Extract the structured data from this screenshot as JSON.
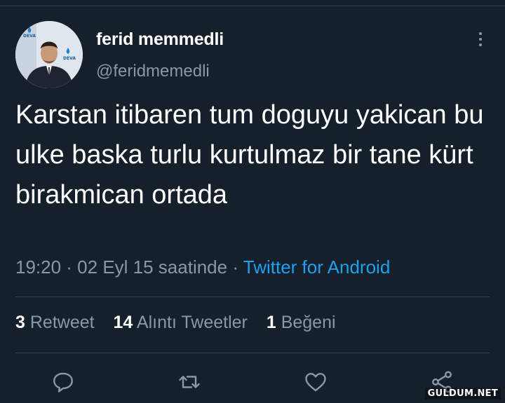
{
  "author": {
    "display_name": "ferid memmedli",
    "handle": "@feridmemedli",
    "avatar_badge_text": "DEVA"
  },
  "tweet": {
    "text": "Karstan itibaren tum doguyu yakican bu ulke baska turlu kurtulmaz bir tane kürt birakmican ortada",
    "timestamp": "19:20 · 02 Eyl 15 saatinde",
    "separator": " · ",
    "source": "Twitter for Android"
  },
  "stats": {
    "retweets_count": "3",
    "retweets_label": "Retweet",
    "quotes_count": "14",
    "quotes_label": "Alıntı Tweetler",
    "likes_count": "1",
    "likes_label": "Beğeni"
  },
  "actions": {
    "icons": [
      "reply-icon",
      "retweet-icon",
      "like-icon",
      "share-icon"
    ]
  },
  "watermark": "GULDUM.NET",
  "colors": {
    "background": "#15202b",
    "text": "#ffffff",
    "muted": "#8899a6",
    "accent": "#1da1f2",
    "divider": "#38444d"
  }
}
